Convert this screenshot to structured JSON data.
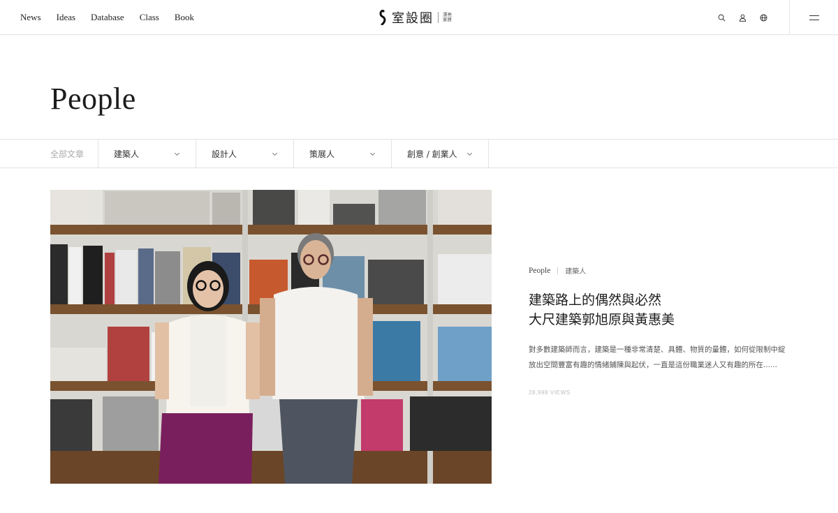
{
  "header": {
    "nav": [
      "News",
      "Ideas",
      "Database",
      "Class",
      "Book"
    ],
    "logo_text": "室設圈",
    "logo_sub": [
      "漂亮",
      "家居"
    ],
    "icons": [
      "search-icon",
      "user-icon",
      "globe-icon",
      "menu-icon"
    ]
  },
  "page": {
    "title": "People"
  },
  "filters": {
    "all": "全部文章",
    "items": [
      "建築人",
      "設計人",
      "策展人",
      "創意 / 創業人"
    ]
  },
  "featured": {
    "category": "People",
    "subcategory": "建築人",
    "title_lines": [
      "建築路上的偶然與必然",
      "大尺建築郭旭原與黃惠美"
    ],
    "excerpt_lines": [
      "對多數建築師而言，建築是一種非常清楚、具體、物質的量體，如何從限制中綻",
      "放出空間豐富有趣的情緒鋪陳與起伏，一直是這份職業迷人又有趣的所在......"
    ],
    "views": "28,998 VIEWS"
  },
  "colors": {
    "text": "#222222",
    "muted": "#aaaaaa",
    "border": "#e3e3e3",
    "skirt": "#7a1f5e"
  }
}
